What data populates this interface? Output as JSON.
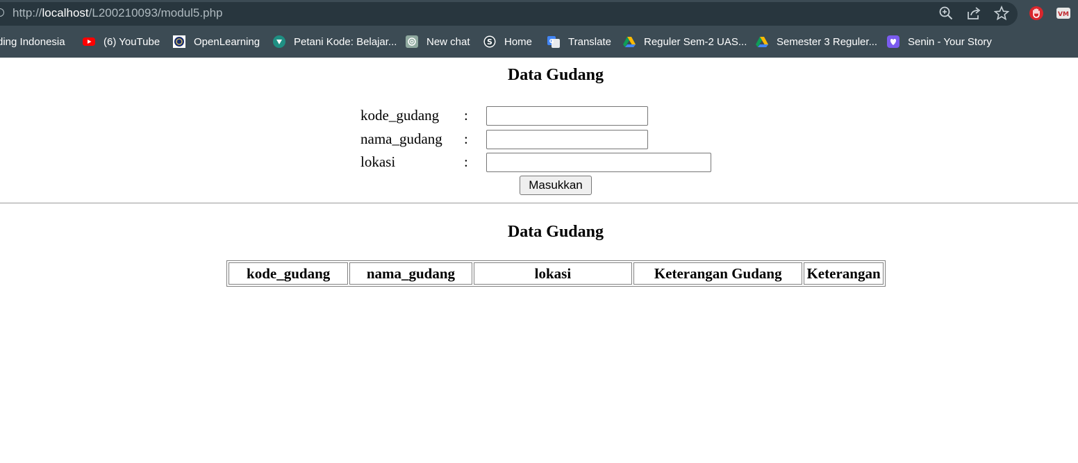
{
  "browser": {
    "url_prefix": "http://",
    "url_host": "localhost",
    "url_path": "/L200210093/modul5.php",
    "bookmarks": [
      {
        "label": "ding Indonesia",
        "icon": "none"
      },
      {
        "label": "(6) YouTube",
        "icon": "youtube-icon"
      },
      {
        "label": "OpenLearning",
        "icon": "openlearning-icon"
      },
      {
        "label": "Petani Kode: Belajar...",
        "icon": "petanikode-icon"
      },
      {
        "label": "New chat",
        "icon": "chatgpt-icon"
      },
      {
        "label": "Home",
        "icon": "s-icon"
      },
      {
        "label": "Translate",
        "icon": "google-translate-icon"
      },
      {
        "label": "Reguler Sem-2 UAS...",
        "icon": "google-drive-icon"
      },
      {
        "label": "Semester 3 Reguler...",
        "icon": "google-drive-icon"
      },
      {
        "label": "Senin - Your Story",
        "icon": "heart-icon"
      }
    ]
  },
  "form": {
    "title": "Data Gudang",
    "fields": [
      {
        "label": "kode_gudang",
        "colon": ":",
        "value": ""
      },
      {
        "label": "nama_gudang",
        "colon": ":",
        "value": ""
      },
      {
        "label": "lokasi",
        "colon": ":",
        "value": ""
      }
    ],
    "submit_label": "Masukkan"
  },
  "table": {
    "title": "Data Gudang",
    "headers": [
      "kode_gudang",
      "nama_gudang",
      "lokasi",
      "Keterangan Gudang",
      "Keterangan"
    ]
  },
  "colors": {
    "chrome_bg": "#3c4b54",
    "address_bg": "#28363e"
  }
}
